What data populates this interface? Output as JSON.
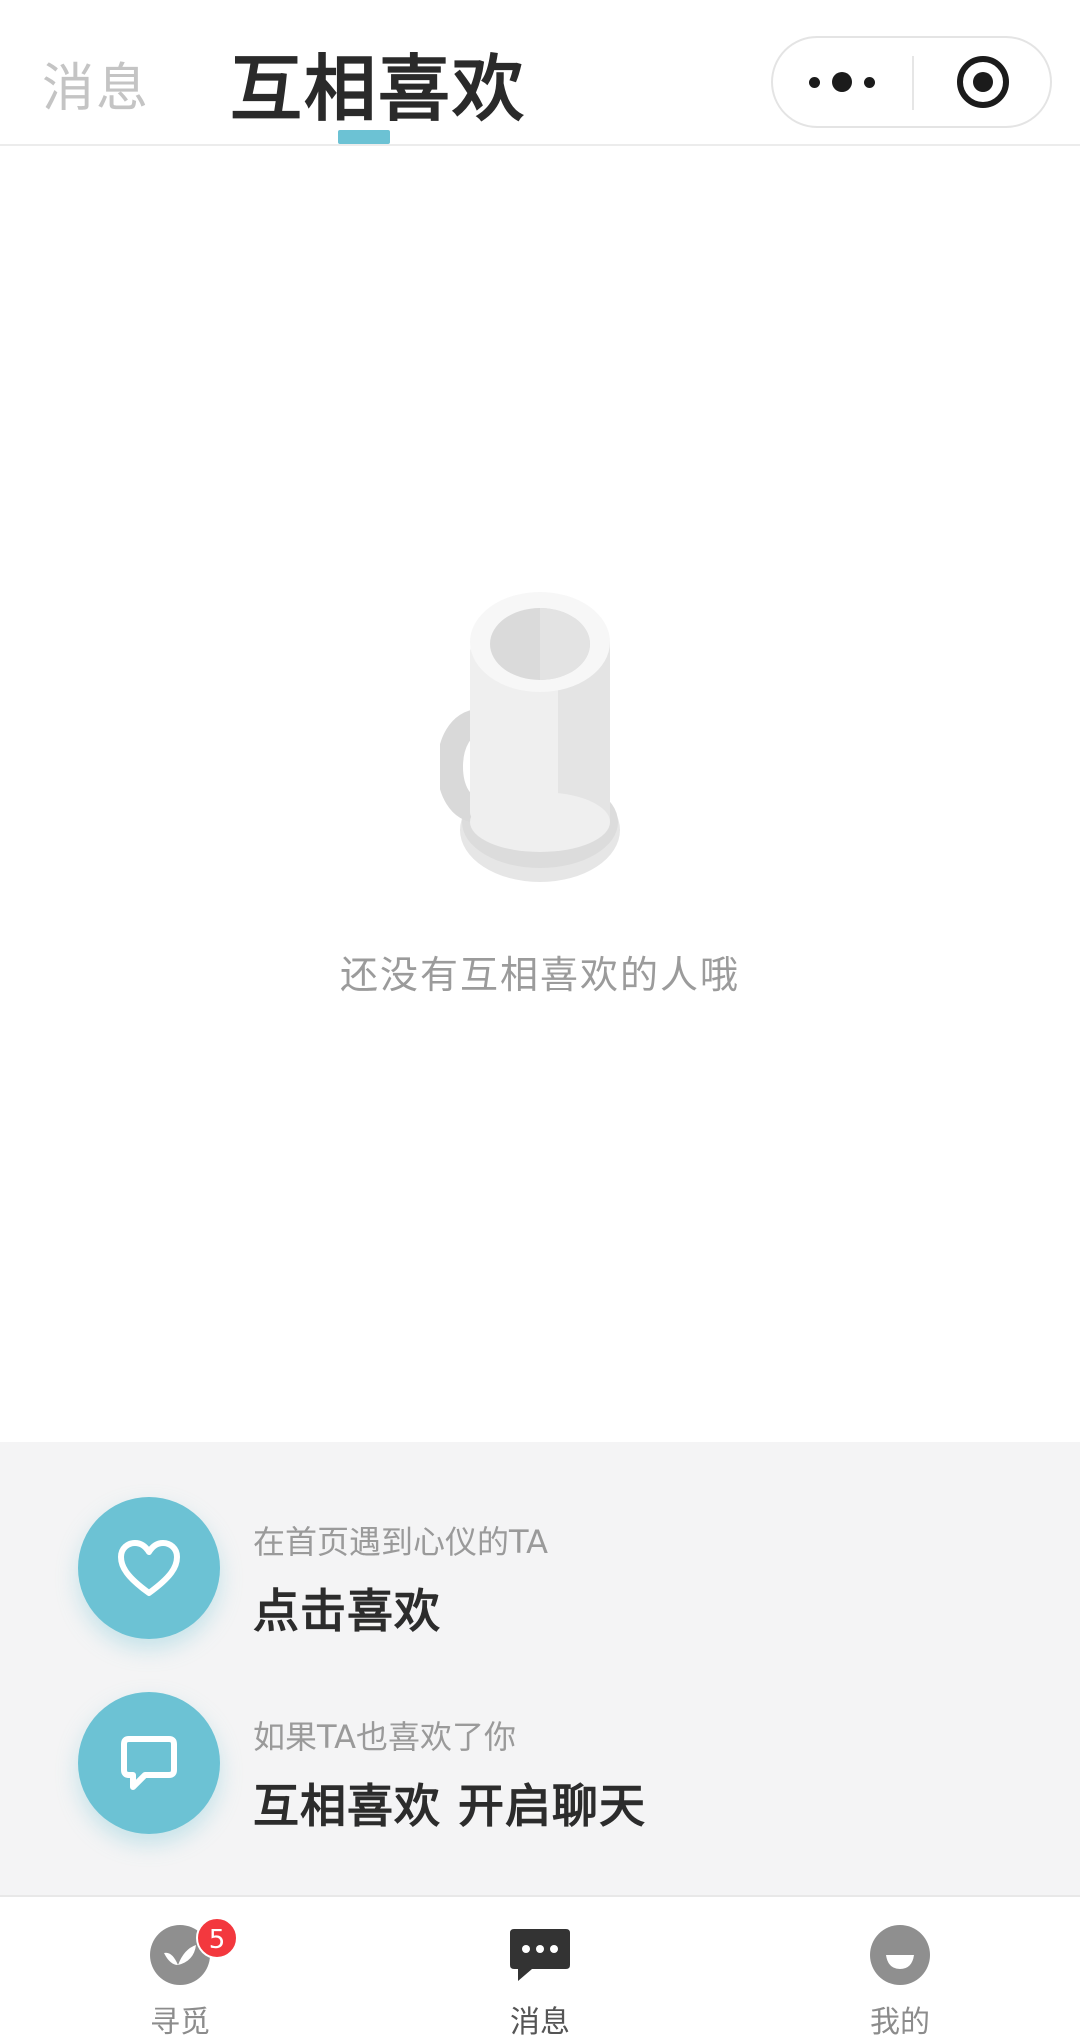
{
  "header": {
    "tab_messages": "消息",
    "tab_mutual_like": "互相喜欢",
    "accent_color": "#6cc2d4"
  },
  "empty_state": {
    "icon": "mug-illustration",
    "text": "还没有互相喜欢的人哦"
  },
  "hints": [
    {
      "icon": "heart-icon",
      "sub": "在首页遇到心仪的TA",
      "main": "点击喜欢"
    },
    {
      "icon": "chat-bubble-icon",
      "sub": "如果TA也喜欢了你",
      "main": "互相喜欢 开启聊天"
    }
  ],
  "tabbar": {
    "items": [
      {
        "label": "寻觅",
        "icon": "leaf-icon",
        "badge": "5"
      },
      {
        "label": "消息",
        "icon": "message-icon",
        "active": true
      },
      {
        "label": "我的",
        "icon": "smile-face-icon"
      }
    ],
    "badge_color": "#f3383e"
  }
}
